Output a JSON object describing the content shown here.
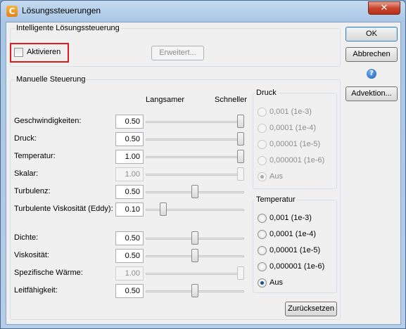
{
  "window": {
    "title": "Lösungssteuerungen",
    "app_icon": "C",
    "close_glyph": "✕"
  },
  "intelligent": {
    "title": "Intelligente Lösungssteuerung",
    "activate_label": "Aktivieren",
    "activate_checked": false,
    "advanced_label": "Erweitert..."
  },
  "manual": {
    "title": "Manuelle Steuerung",
    "slower_label": "Langsamer",
    "faster_label": "Schneller",
    "rows": [
      {
        "label": "Geschwindigkeiten:",
        "value": "0.50",
        "slider": 1.0,
        "enabled": true
      },
      {
        "label": "Druck:",
        "value": "0.50",
        "slider": 1.0,
        "enabled": true
      },
      {
        "label": "Temperatur:",
        "value": "1.00",
        "slider": 1.0,
        "enabled": true
      },
      {
        "label": "Skalar:",
        "value": "1.00",
        "slider": 1.0,
        "enabled": false
      },
      {
        "label": "Turbulenz:",
        "value": "0.50",
        "slider": 0.5,
        "enabled": true
      },
      {
        "label": "Turbulente Viskosität (Eddy):",
        "value": "0.10",
        "slider": 0.15,
        "enabled": true
      },
      {
        "label": "Dichte:",
        "value": "0.50",
        "slider": 0.5,
        "enabled": true
      },
      {
        "label": "Viskosität:",
        "value": "0.50",
        "slider": 0.5,
        "enabled": true
      },
      {
        "label": "Spezifische Wärme:",
        "value": "1.00",
        "slider": 1.0,
        "enabled": false
      },
      {
        "label": "Leitfähigkeit:",
        "value": "0.50",
        "slider": 0.5,
        "enabled": true
      }
    ]
  },
  "pressure": {
    "title": "Druck",
    "enabled": false,
    "options": [
      "0,001 (1e-3)",
      "0,0001 (1e-4)",
      "0,00001 (1e-5)",
      "0,000001 (1e-6)",
      "Aus"
    ],
    "selected": 4
  },
  "temperature": {
    "title": "Temperatur",
    "enabled": true,
    "options": [
      "0,001 (1e-3)",
      "0,0001 (1e-4)",
      "0,00001 (1e-5)",
      "0,000001 (1e-6)",
      "Aus"
    ],
    "selected": 4
  },
  "buttons": {
    "ok": "OK",
    "cancel": "Abbrechen",
    "advection": "Advektion...",
    "reset": "Zurücksetzen"
  },
  "help_glyph": "?"
}
